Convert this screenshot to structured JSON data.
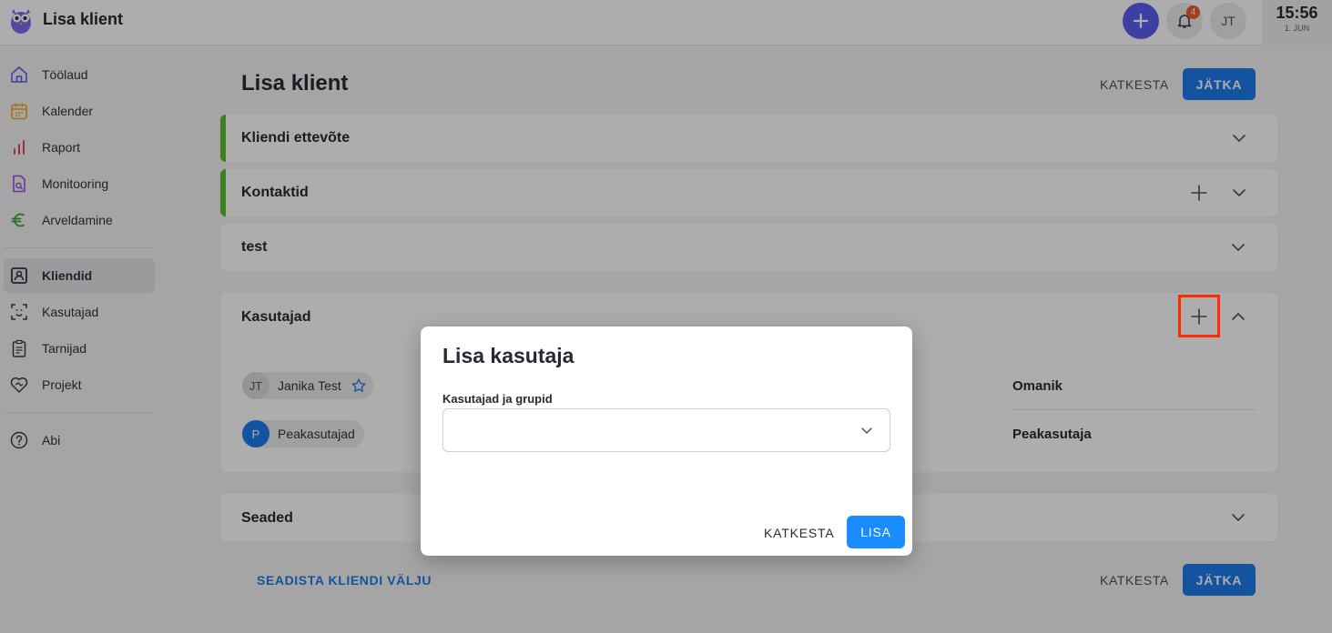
{
  "header": {
    "app_title": "Lisa klient",
    "notification_count": "4",
    "user_initials": "JT",
    "clock_time": "15:56",
    "clock_date": "1. JUN"
  },
  "sidebar": {
    "items": [
      {
        "label": "Töölaud",
        "icon": "home-icon",
        "color": "#5b5ff0"
      },
      {
        "label": "Kalender",
        "icon": "calendar-icon",
        "color": "#f5a623"
      },
      {
        "label": "Raport",
        "icon": "bar-chart-icon",
        "color": "#e8475f"
      },
      {
        "label": "Monitooring",
        "icon": "document-search-icon",
        "color": "#9b51e0"
      },
      {
        "label": "Arveldamine",
        "icon": "euro-icon",
        "color": "#3fa535"
      },
      {
        "label": "Kliendid",
        "icon": "client-card-icon",
        "active": true
      },
      {
        "label": "Kasutajad",
        "icon": "user-scan-icon"
      },
      {
        "label": "Tarnijad",
        "icon": "clipboard-icon"
      },
      {
        "label": "Projekt",
        "icon": "heart-handshake-icon"
      },
      {
        "label": "Abi",
        "icon": "help-icon"
      }
    ]
  },
  "main": {
    "title": "Lisa klient",
    "cancel_label": "KATKESTA",
    "continue_label": "JÄTKA",
    "panels": {
      "company": "Kliendi ettevõte",
      "contacts": "Kontaktid",
      "test": "test",
      "users": "Kasutajad",
      "settings": "Seaded"
    },
    "users": [
      {
        "initials": "JT",
        "name": "Janika Test",
        "role": "Omanik"
      },
      {
        "initials": "P",
        "name": "Peakasutajad",
        "role": "Peakasutaja"
      }
    ],
    "setup_link": "SEADISTA KLIENDI VÄLJU"
  },
  "modal": {
    "title": "Lisa kasutaja",
    "field_label": "Kasutajad ja grupid",
    "field_value": "",
    "cancel_label": "KATKESTA",
    "add_label": "LISA"
  },
  "colors": {
    "primary": "#1e7bea",
    "accent": "#5b5ff0",
    "panel_accent": "#5cbb2f",
    "highlight": "#ff2a00"
  }
}
